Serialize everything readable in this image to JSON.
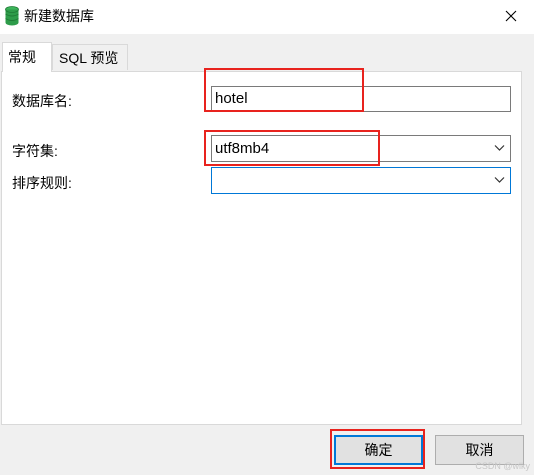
{
  "window": {
    "title": "新建数据库",
    "close_glyph": "✕"
  },
  "tabs": [
    {
      "label": "常规",
      "active": true
    },
    {
      "label": "SQL 预览",
      "active": false
    }
  ],
  "form": {
    "db_name": {
      "label": "数据库名:",
      "value": "hotel"
    },
    "charset": {
      "label": "字符集:",
      "value": "utf8mb4"
    },
    "collation": {
      "label": "排序规则:",
      "value": ""
    }
  },
  "buttons": {
    "ok": "确定",
    "cancel": "取消"
  },
  "watermark": "CSDN @wlky",
  "colors": {
    "annotation": "#e8231e",
    "focus": "#0078d7",
    "db_icon": "#2e9c4a"
  },
  "icons": {
    "app": "database-icon",
    "close": "close-icon",
    "dropdown": "chevron-down-icon"
  }
}
